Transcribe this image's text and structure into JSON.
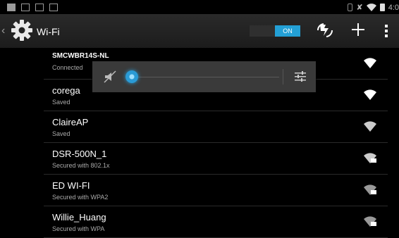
{
  "status_bar": {
    "time": "4:0",
    "left_icons": [
      "picture-icon",
      "notification-icon",
      "sdcard-icon",
      "image-icon"
    ],
    "right_icons": [
      "bluetooth-icon",
      "mute-icon",
      "wifi-icon",
      "battery-icon"
    ]
  },
  "action_bar": {
    "title": "Wi-Fi",
    "toggle_label": "ON",
    "accent": "#23a0d6"
  },
  "networks": [
    {
      "ssid": "SMCWBR14S-NL",
      "status": "Connected",
      "secured": false
    },
    {
      "ssid": "corega",
      "status": "Saved",
      "secured": false
    },
    {
      "ssid": "ClaireAP",
      "status": "Saved",
      "secured": false
    },
    {
      "ssid": "DSR-500N_1",
      "status": "Secured with 802.1x",
      "secured": true
    },
    {
      "ssid": "ED WI-FI",
      "status": "Secured with WPA2",
      "secured": true
    },
    {
      "ssid": "Willie_Huang",
      "status": "Secured with WPA",
      "secured": true
    }
  ],
  "volume_popup": {
    "level": 0.0
  }
}
